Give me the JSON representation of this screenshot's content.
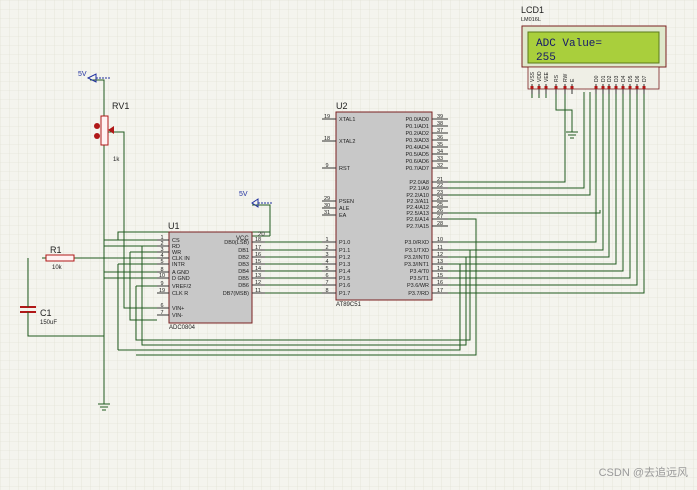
{
  "lcd": {
    "ref": "LCD1",
    "model": "LM016L",
    "line1": "ADC Value=",
    "line2": "255",
    "pins": [
      "VSS",
      "VDD",
      "VEE",
      "RS",
      "RW",
      "E",
      "D0",
      "D1",
      "D2",
      "D3",
      "D4",
      "D5",
      "D6",
      "D7"
    ]
  },
  "mcu": {
    "ref": "U2",
    "model": "AT89C51",
    "left_pins": [
      {
        "num": "19",
        "name": "XTAL1"
      },
      {
        "num": "18",
        "name": "XTAL2"
      },
      {
        "num": "9",
        "name": "RST"
      },
      {
        "num": "29",
        "name": "PSEN"
      },
      {
        "num": "30",
        "name": "ALE"
      },
      {
        "num": "31",
        "name": "EA"
      },
      {
        "num": "1",
        "name": "P1.0"
      },
      {
        "num": "2",
        "name": "P1.1"
      },
      {
        "num": "3",
        "name": "P1.2"
      },
      {
        "num": "4",
        "name": "P1.3"
      },
      {
        "num": "5",
        "name": "P1.4"
      },
      {
        "num": "6",
        "name": "P1.5"
      },
      {
        "num": "7",
        "name": "P1.6"
      },
      {
        "num": "8",
        "name": "P1.7"
      }
    ],
    "right_pins": [
      {
        "num": "39",
        "name": "P0.0/AD0"
      },
      {
        "num": "38",
        "name": "P0.1/AD1"
      },
      {
        "num": "37",
        "name": "P0.2/AD2"
      },
      {
        "num": "36",
        "name": "P0.3/AD3"
      },
      {
        "num": "35",
        "name": "P0.4/AD4"
      },
      {
        "num": "34",
        "name": "P0.5/AD5"
      },
      {
        "num": "33",
        "name": "P0.6/AD6"
      },
      {
        "num": "32",
        "name": "P0.7/AD7"
      },
      {
        "num": "21",
        "name": "P2.0/A8"
      },
      {
        "num": "22",
        "name": "P2.1/A9"
      },
      {
        "num": "23",
        "name": "P2.2/A10"
      },
      {
        "num": "24",
        "name": "P2.3/A11"
      },
      {
        "num": "25",
        "name": "P2.4/A12"
      },
      {
        "num": "26",
        "name": "P2.5/A13"
      },
      {
        "num": "27",
        "name": "P2.6/A14"
      },
      {
        "num": "28",
        "name": "P2.7/A15"
      },
      {
        "num": "10",
        "name": "P3.0/RXD"
      },
      {
        "num": "11",
        "name": "P3.1/TXD"
      },
      {
        "num": "12",
        "name": "P3.2/INT0"
      },
      {
        "num": "13",
        "name": "P3.3/INT1"
      },
      {
        "num": "14",
        "name": "P3.4/T0"
      },
      {
        "num": "15",
        "name": "P3.5/T1"
      },
      {
        "num": "16",
        "name": "P3.6/WR"
      },
      {
        "num": "17",
        "name": "P3.7/RD"
      }
    ]
  },
  "adc": {
    "ref": "U1",
    "model": "ADC0804",
    "left_pins": [
      {
        "num": "1",
        "name": "CS"
      },
      {
        "num": "2",
        "name": "RD"
      },
      {
        "num": "3",
        "name": "WR"
      },
      {
        "num": "4",
        "name": "CLK IN"
      },
      {
        "num": "5",
        "name": "INTR"
      },
      {
        "num": "8",
        "name": "A GND"
      },
      {
        "num": "10",
        "name": "D GND"
      },
      {
        "num": "9",
        "name": "VREF/2"
      },
      {
        "num": "19",
        "name": "CLK R"
      },
      {
        "num": "6",
        "name": "VIN+"
      },
      {
        "num": "7",
        "name": "VIN-"
      }
    ],
    "vcc": {
      "num": "20",
      "name": "VCC"
    },
    "right_pins": [
      {
        "num": "18",
        "name": "DB0(LSB)"
      },
      {
        "num": "17",
        "name": "DB1"
      },
      {
        "num": "16",
        "name": "DB2"
      },
      {
        "num": "15",
        "name": "DB3"
      },
      {
        "num": "14",
        "name": "DB4"
      },
      {
        "num": "13",
        "name": "DB5"
      },
      {
        "num": "12",
        "name": "DB6"
      },
      {
        "num": "11",
        "name": "DB7(MSB)"
      }
    ]
  },
  "rv1": {
    "ref": "RV1",
    "value": "1k"
  },
  "r1": {
    "ref": "R1",
    "value": "10k"
  },
  "c1": {
    "ref": "C1",
    "value": "150uF"
  },
  "power_label_top": "5V",
  "power_label_adc": "5V",
  "watermark": "CSDN @去追远风",
  "colors": {
    "background": "#f4f4ee",
    "grid": "#dcdccf",
    "wire": "#1f5a1f",
    "body_fill": "#c8c8c8",
    "component": "#b01818",
    "lcd_screen": "#a9cf3c",
    "lcd_text": "#16186a"
  }
}
